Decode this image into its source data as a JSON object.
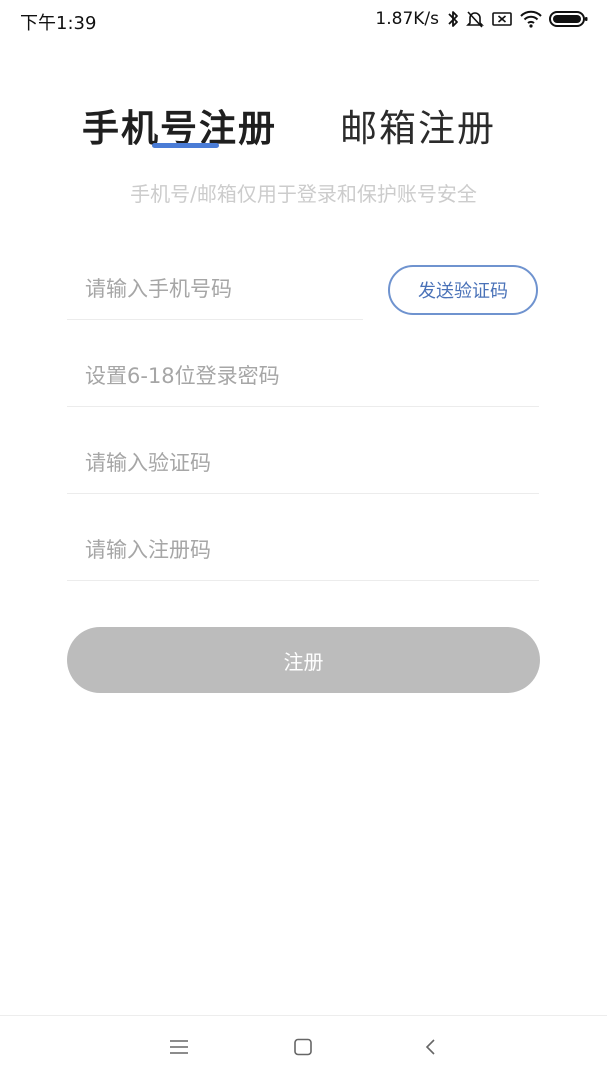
{
  "status_bar": {
    "time": "下午1:39",
    "net_speed": "1.87K/s",
    "icons": [
      "bluetooth-icon",
      "alarm-off-icon",
      "sim-disabled-icon",
      "wifi-icon",
      "battery-icon"
    ]
  },
  "tabs": [
    {
      "label": "手机号注册",
      "active": true
    },
    {
      "label": "邮箱注册",
      "active": false
    }
  ],
  "subtitle": "手机号/邮箱仅用于登录和保护账号安全",
  "form": {
    "phone_placeholder": "请输入手机号码",
    "send_code_label": "发送验证码",
    "password_placeholder": "设置6-18位登录密码",
    "verify_code_placeholder": "请输入验证码",
    "register_code_placeholder": "请输入注册码",
    "register_label": "注册"
  },
  "colors": {
    "accent": "#4a7cd6",
    "send_code_border": "#6f93cf",
    "register_button_disabled": "#bcbcbc",
    "subtitle": "#cccccc",
    "placeholder": "#a6a6a6"
  },
  "nav_bar": {
    "icons": [
      "menu-icon",
      "home-icon",
      "back-icon"
    ]
  }
}
